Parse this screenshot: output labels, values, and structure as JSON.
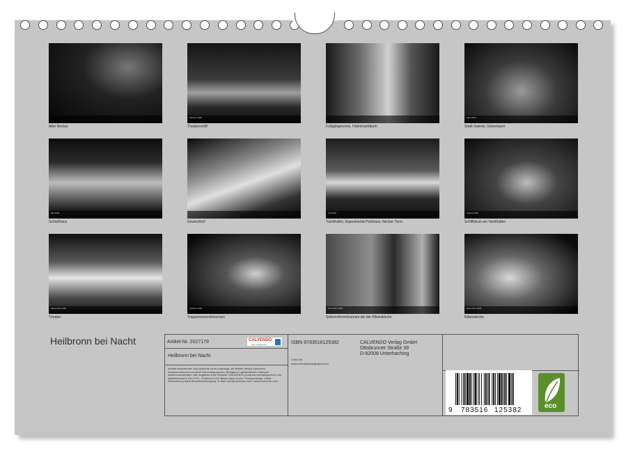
{
  "calendar": {
    "cover_title": "Heilbronn bei Nacht",
    "months": [
      {
        "caption": "Alter Neckar",
        "calendar_label": ""
      },
      {
        "caption": "Theaterschiff",
        "calendar_label": "Februar 2026"
      },
      {
        "caption": "Fußgängerzone, Hafenmarktturm",
        "calendar_label": ""
      },
      {
        "caption": "Stadt-Galerie, Götzenturm",
        "calendar_label": "April 2026"
      },
      {
        "caption": "Schießhaus",
        "calendar_label": "Mai 2026"
      },
      {
        "caption": "Deutschhof",
        "calendar_label": ""
      },
      {
        "caption": "Yachthafen, Experimenta Parkhaus, Neckar-Turm",
        "calendar_label": "Juli 2026"
      },
      {
        "caption": "Schiffskran am Yachthafen",
        "calendar_label": "August 2026"
      },
      {
        "caption": "Theater",
        "calendar_label": "September 2026"
      },
      {
        "caption": "Trappenseeschlösschen",
        "calendar_label": "Oktober 2026"
      },
      {
        "caption": "Siebenröhrenbrunnen bei der Kilianskirche",
        "calendar_label": "November 2026"
      },
      {
        "caption": "Kilianskirche",
        "calendar_label": "Dezember 2026"
      }
    ]
  },
  "info": {
    "article_number": "Artikel-Nr. 2027179",
    "product_title": "Heilbronn bei Nacht",
    "isbn": "ISBN 9783516125382",
    "photographer": "Colin Utz",
    "website": "www.colinutzphotography.com",
    "publisher_name": "CALVENDO Verlag GmbH",
    "publisher_street": "Ottobrunner Straße 39",
    "publisher_city": "D-82008 Unterhaching",
    "legal_text": "Inhalte bestehender Schutzrechte ist es untersagt, die Blätter dieses Kalenders herauszutrennen und ohne Genehmigung des Verlages zu gewerblichen Zwecken weiterzuverwenden. Alle Angaben ohne Gewähr. CALVENDO produziert bedarfsgerecht und klimabewusst in DE & EU. Positivere CO2-Bilanz dank kurzer Transportwege, Abfall-Reduzierung dank Einzelstückfertigung. E-Mail: info@calvendo.com • www.calvendo.com",
    "logo_text": "CALVENDO",
    "logo_sub": "das Verlagshaus",
    "barcode_digits": [
      "9",
      "783516",
      "125382"
    ],
    "eco_label": "eco"
  },
  "colors": {
    "page_bg": "#c6c6c6",
    "eco_green": "#5a8f2a",
    "logo_red": "#c0392b"
  }
}
